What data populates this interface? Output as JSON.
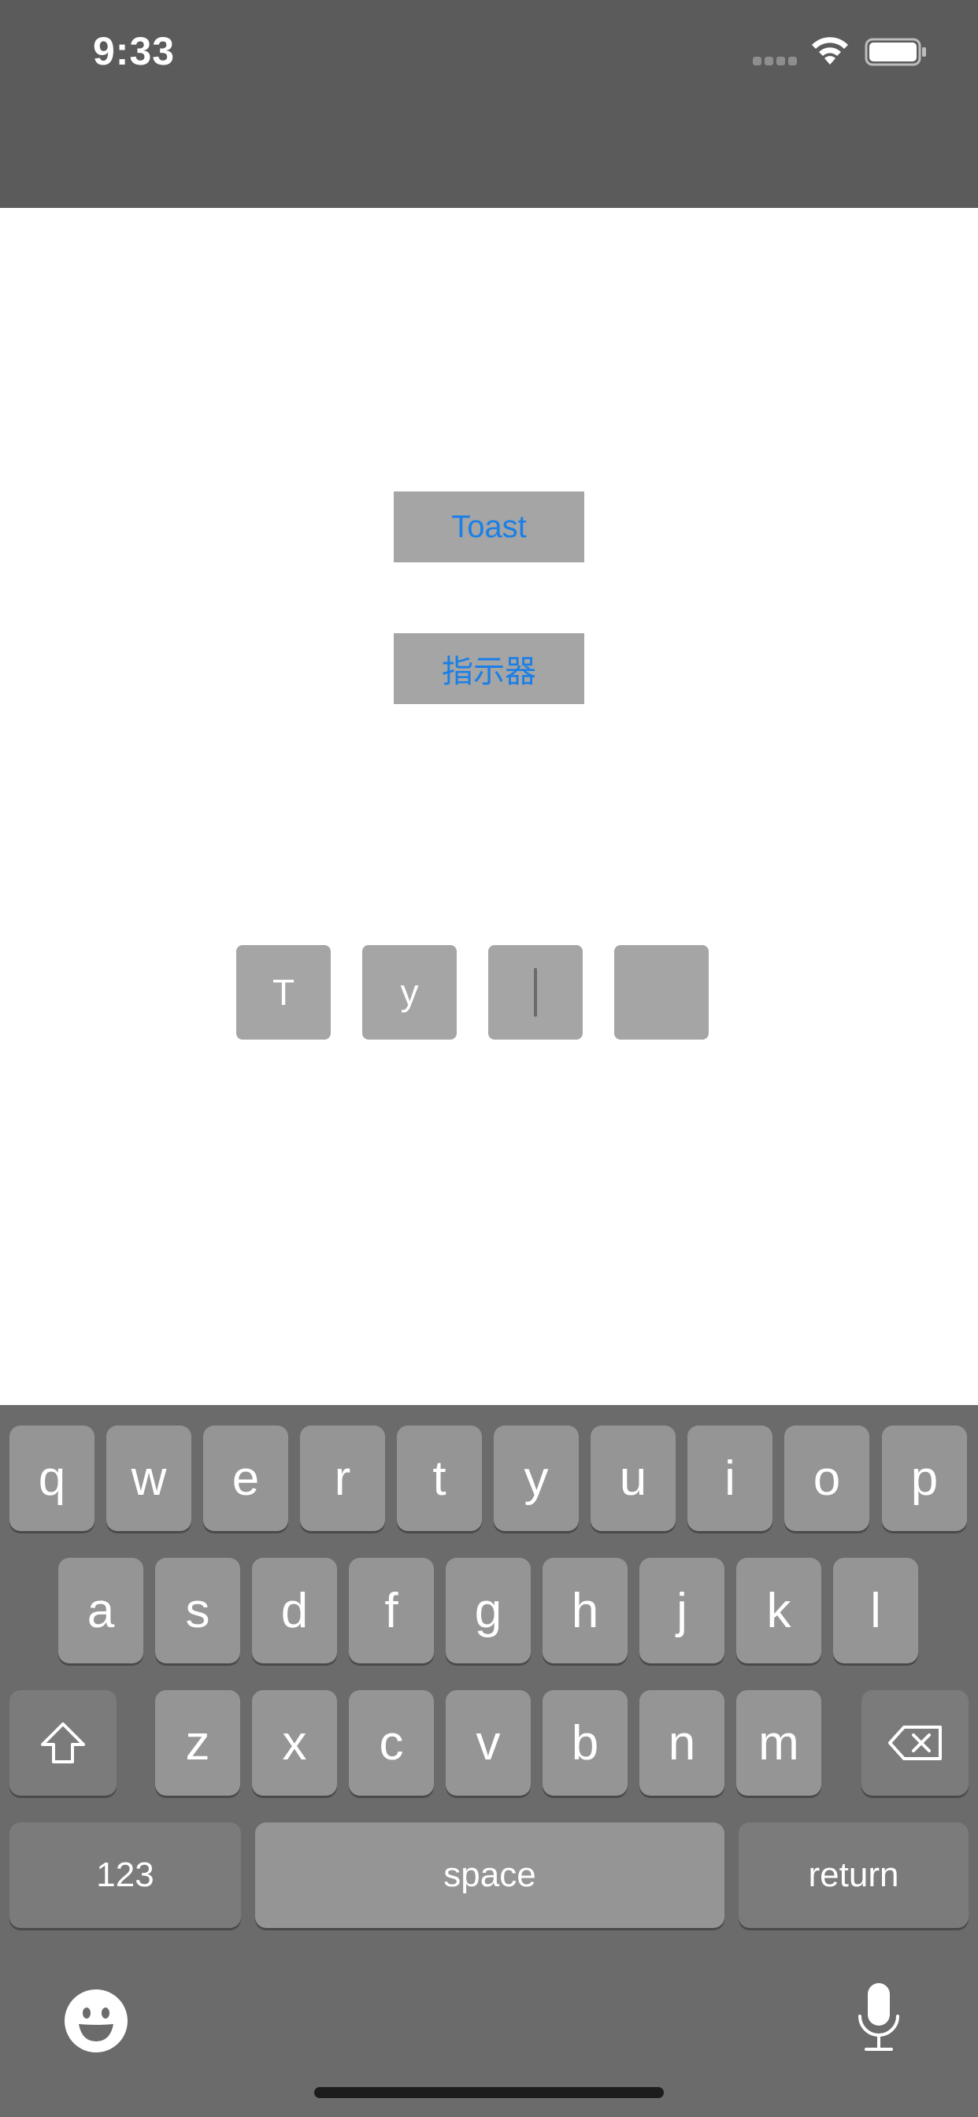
{
  "status_bar": {
    "time": "9:33"
  },
  "main": {
    "toast_button_label": "Toast",
    "indicator_button_label": "指示器",
    "code_input": {
      "chars": [
        "T",
        "y",
        "",
        ""
      ],
      "focused_index": 2
    }
  },
  "keyboard": {
    "row1": [
      "q",
      "w",
      "e",
      "r",
      "t",
      "y",
      "u",
      "i",
      "o",
      "p"
    ],
    "row2": [
      "a",
      "s",
      "d",
      "f",
      "g",
      "h",
      "j",
      "k",
      "l"
    ],
    "row3": [
      "z",
      "x",
      "c",
      "v",
      "b",
      "n",
      "m"
    ],
    "numbers_label": "123",
    "space_label": "space",
    "return_label": "return"
  },
  "colors": {
    "status_bar_bg": "#5b5b5b",
    "button_bg": "#a5a5a5",
    "button_text": "#1a7fe6",
    "keyboard_bg": "#6b6b6b",
    "key_bg": "#959595",
    "key_dark_bg": "#7b7b7b"
  },
  "icons": {
    "signal": "cellular-signal-icon",
    "wifi": "wifi-icon",
    "battery": "battery-icon",
    "shift": "shift-icon",
    "delete": "delete-icon",
    "emoji": "emoji-icon",
    "mic": "microphone-icon"
  }
}
